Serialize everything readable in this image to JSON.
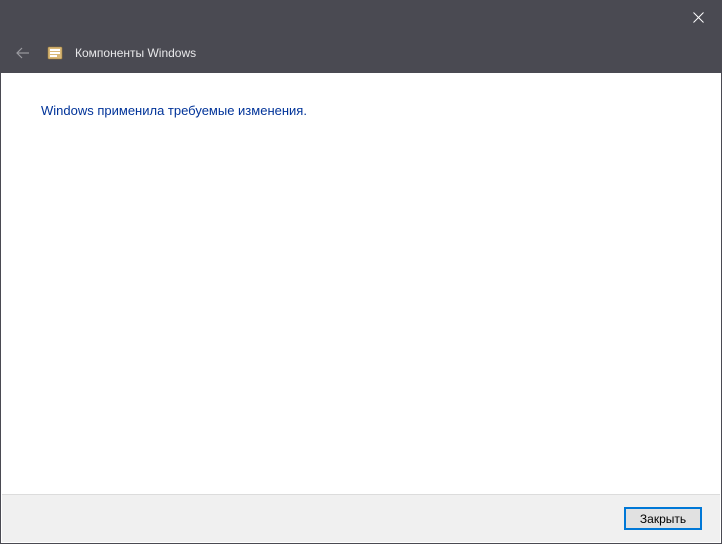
{
  "titlebar": {
    "close_tooltip": "Close"
  },
  "header": {
    "title": "Компоненты Windows"
  },
  "content": {
    "message": "Windows применила требуемые изменения."
  },
  "footer": {
    "close_label": "Закрыть"
  }
}
